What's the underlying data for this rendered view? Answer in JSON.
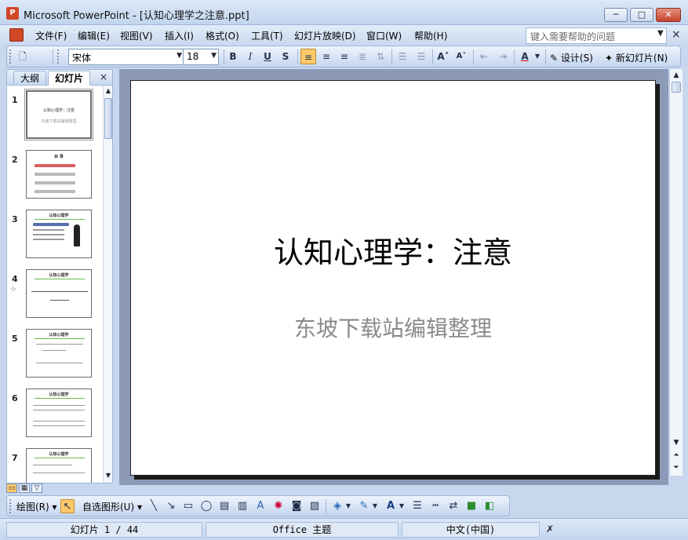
{
  "app": {
    "title": "Microsoft PowerPoint - [认知心理学之注意.ppt]",
    "icon_label": "P"
  },
  "window_controls": {
    "minimize": "─",
    "maximize": "□",
    "close": "✕"
  },
  "menubar": {
    "items": [
      "文件(F)",
      "编辑(E)",
      "视图(V)",
      "插入(I)",
      "格式(O)",
      "工具(T)",
      "幻灯片放映(D)",
      "窗口(W)",
      "帮助(H)"
    ],
    "help_placeholder": "键入需要帮助的问题",
    "close_glyph": "×"
  },
  "format_toolbar": {
    "font_name": "宋体",
    "font_size": "18",
    "bold": "B",
    "italic": "I",
    "underline": "U",
    "shadow": "S",
    "design_label": "设计(S)",
    "new_slide_label": "新幻灯片(N)"
  },
  "left_pane": {
    "tabs": [
      "大纲",
      "幻灯片"
    ],
    "active_tab": "幻灯片",
    "close_glyph": "×",
    "slides": [
      {
        "number": "1",
        "title": "认知心理学：注意",
        "subtitle": "东坡下载站编辑整理"
      },
      {
        "number": "2",
        "title": "目 录"
      },
      {
        "number": "3",
        "title": "认知心理学"
      },
      {
        "number": "4",
        "title": "认知心理学"
      },
      {
        "number": "5",
        "title": "认知心理学"
      },
      {
        "number": "6",
        "title": "认知心理学"
      },
      {
        "number": "7",
        "title": "认知心理学"
      }
    ]
  },
  "slide": {
    "title": "认知心理学：注意",
    "subtitle": "东坡下载站编辑整理"
  },
  "drawing_toolbar": {
    "draw_label": "绘图(R)",
    "autoshapes_label": "自选图形(U)"
  },
  "status": {
    "slide_position": "幻灯片 1 / 44",
    "theme": "Office 主题",
    "language": "中文(中国)"
  },
  "colors": {
    "accent": "#ffc96b",
    "chrome": "#c7d7ee",
    "editor_bg": "#8c9ab8",
    "subtitle_gray": "#8a8a8a"
  }
}
